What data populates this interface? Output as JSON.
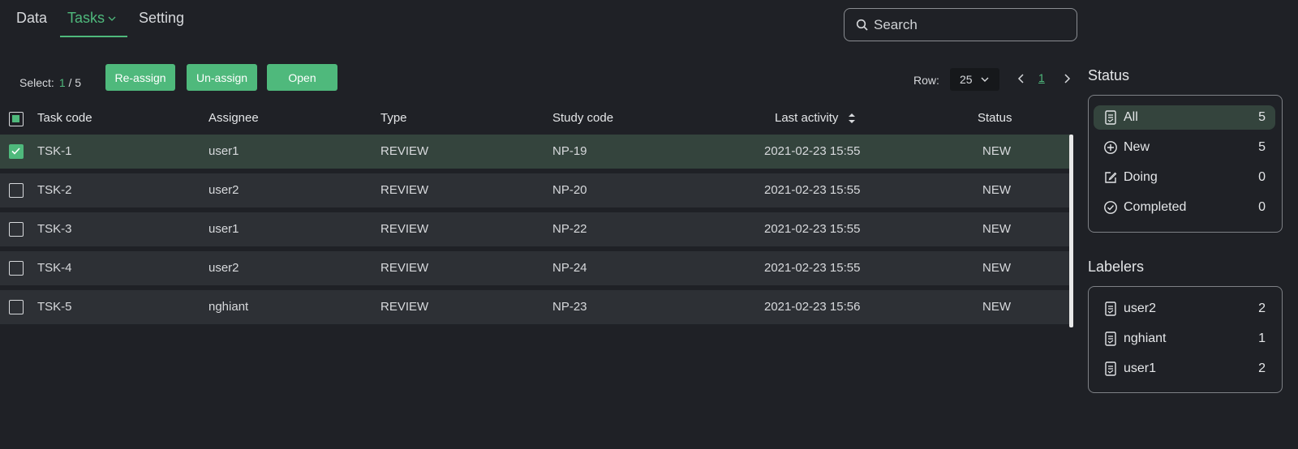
{
  "nav": {
    "tabs": [
      {
        "label": "Data"
      },
      {
        "label": "Tasks",
        "active": true
      },
      {
        "label": "Setting"
      }
    ]
  },
  "search": {
    "placeholder": "Search"
  },
  "toolbar": {
    "select_label": "Select:",
    "select_current": "1",
    "select_total": "/ 5",
    "reassign_label": "Re-assign",
    "unassign_label": "Un-assign",
    "open_label": "Open",
    "row_label": "Row:",
    "row_value": "25",
    "page": "1"
  },
  "table": {
    "headers": {
      "task_code": "Task code",
      "assignee": "Assignee",
      "type": "Type",
      "study_code": "Study code",
      "last_activity": "Last activity",
      "status": "Status"
    },
    "rows": [
      {
        "task_code": "TSK-1",
        "assignee": "user1",
        "type": "REVIEW",
        "study_code": "NP-19",
        "last_activity": "2021-02-23 15:55",
        "status": "NEW",
        "checked": true
      },
      {
        "task_code": "TSK-2",
        "assignee": "user2",
        "type": "REVIEW",
        "study_code": "NP-20",
        "last_activity": "2021-02-23 15:55",
        "status": "NEW",
        "checked": false
      },
      {
        "task_code": "TSK-3",
        "assignee": "user1",
        "type": "REVIEW",
        "study_code": "NP-22",
        "last_activity": "2021-02-23 15:55",
        "status": "NEW",
        "checked": false
      },
      {
        "task_code": "TSK-4",
        "assignee": "user2",
        "type": "REVIEW",
        "study_code": "NP-24",
        "last_activity": "2021-02-23 15:55",
        "status": "NEW",
        "checked": false
      },
      {
        "task_code": "TSK-5",
        "assignee": "nghiant",
        "type": "REVIEW",
        "study_code": "NP-23",
        "last_activity": "2021-02-23 15:56",
        "status": "NEW",
        "checked": false
      }
    ]
  },
  "status_panel": {
    "title": "Status",
    "items": [
      {
        "label": "All",
        "count": "5",
        "icon": "document-icon",
        "active": true
      },
      {
        "label": "New",
        "count": "5",
        "icon": "plus-circle-icon"
      },
      {
        "label": "Doing",
        "count": "0",
        "icon": "edit-icon"
      },
      {
        "label": "Completed",
        "count": "0",
        "icon": "check-circle-icon"
      }
    ]
  },
  "labelers_panel": {
    "title": "Labelers",
    "items": [
      {
        "label": "user2",
        "count": "2",
        "icon": "document-icon"
      },
      {
        "label": "nghiant",
        "count": "1",
        "icon": "document-icon"
      },
      {
        "label": "user1",
        "count": "2",
        "icon": "document-icon"
      }
    ]
  },
  "colors": {
    "accent": "#4fb97c",
    "background": "#1f2126",
    "row": "#2d3035",
    "row_selected": "#34443d"
  }
}
